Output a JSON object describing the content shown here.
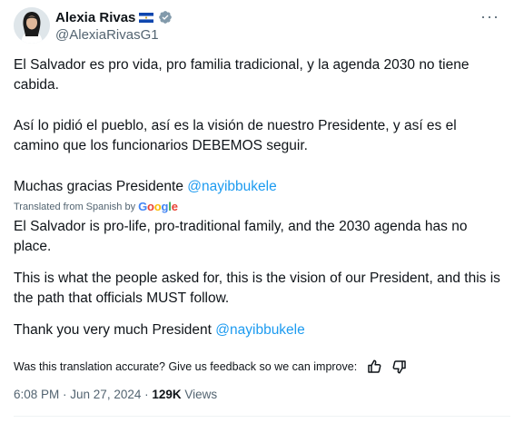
{
  "author": {
    "display_name": "Alexia Rivas",
    "handle": "@AlexiaRivasG1",
    "verified_badge_color": "#829aab",
    "flag": "el-salvador-flag"
  },
  "more_menu": {
    "label": "···"
  },
  "original_text": {
    "p1": "El Salvador es pro vida, pro familia tradicional, y la agenda 2030 no tiene cabida.",
    "p2": "Así lo pidió el pueblo, así es la visión de nuestro Presidente, y así es el camino que los funcionarios DEBEMOS seguir.",
    "p3_prefix": "Muchas gracias Presidente ",
    "p3_mention": "@nayibbukele"
  },
  "translation_note": {
    "label": "Translated from Spanish by",
    "provider_letters": [
      "G",
      "o",
      "o",
      "g",
      "l",
      "e"
    ]
  },
  "translated_text": {
    "p1": "El Salvador is pro-life, pro-traditional family, and the 2030 agenda has no place.",
    "p2": "This is what the people asked for, this is the vision of our President, and this is the path that officials MUST follow.",
    "p3_prefix": "Thank you very much President ",
    "p3_mention": "@nayibbukele"
  },
  "feedback": {
    "prompt": "Was this translation accurate? Give us feedback so we can improve:"
  },
  "meta": {
    "time": "6:08 PM",
    "separator": " · ",
    "date": "Jun 27, 2024",
    "views_count": "129K",
    "views_label": " Views"
  },
  "colors": {
    "link": "#1d9bf0",
    "secondary_text": "#536471",
    "primary_text": "#0f1419"
  }
}
